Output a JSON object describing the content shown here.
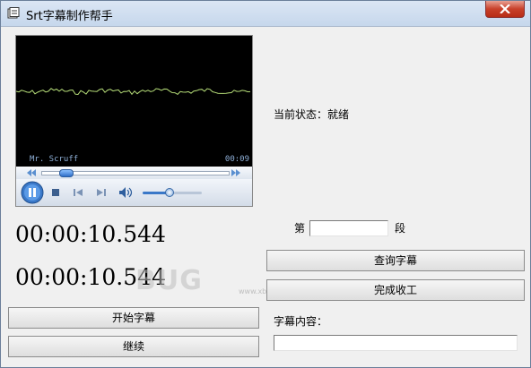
{
  "window": {
    "title": "Srt字幕制作帮手"
  },
  "player": {
    "track_name": "Mr. Scruff",
    "elapsed": "00:09",
    "seek_progress": 0.1,
    "volume_level": 0.45
  },
  "status": {
    "text": "当前状态：就绪"
  },
  "timers": {
    "start": "00:00:10.544",
    "end": "00:00:10.544"
  },
  "segment": {
    "prefix": "第",
    "suffix": "段",
    "value": ""
  },
  "buttons": {
    "query": "查询字幕",
    "finish": "完成收工",
    "start": "开始字幕",
    "continue": "继续"
  },
  "subtitle": {
    "label": "字幕内容：",
    "value": ""
  },
  "watermark": {
    "text": "BUG",
    "sub": "www.xbug.com"
  }
}
